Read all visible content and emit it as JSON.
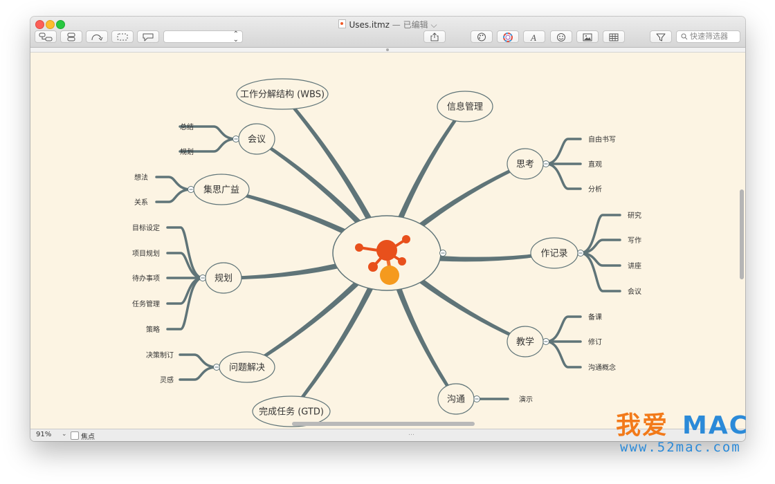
{
  "window": {
    "title": "Uses.itmz",
    "title_suffix": "— 已编辑",
    "title_chevron": "⌵"
  },
  "toolbar": {
    "style_select_value": "",
    "search_placeholder": "快速筛选器"
  },
  "mindmap": {
    "central_icon": "ithoughts-logo",
    "branches": [
      {
        "id": "wbs",
        "label": "工作分解结构 (WBS)",
        "children": []
      },
      {
        "id": "info",
        "label": "信息管理",
        "children": []
      },
      {
        "id": "meeting",
        "label": "会议",
        "children": [
          "总结",
          "规划"
        ]
      },
      {
        "id": "think",
        "label": "思考",
        "children": [
          "自由书写",
          "直观",
          "分析"
        ]
      },
      {
        "id": "brainstorm",
        "label": "集思广益",
        "children": [
          "想法",
          "关系"
        ]
      },
      {
        "id": "notes",
        "label": "作记录",
        "children": [
          "研究",
          "写作",
          "讲座",
          "会议"
        ]
      },
      {
        "id": "plan",
        "label": "规划",
        "children": [
          "目标设定",
          "项目规划",
          "待办事项",
          "任务管理",
          "策略"
        ]
      },
      {
        "id": "teach",
        "label": "教学",
        "children": [
          "备课",
          "修订",
          "沟通概念"
        ]
      },
      {
        "id": "problem",
        "label": "问题解决",
        "children": [
          "决策制订",
          "灵感"
        ]
      },
      {
        "id": "comm",
        "label": "沟通",
        "children": [
          "演示"
        ]
      },
      {
        "id": "gtd",
        "label": "完成任务 (GTD)",
        "children": []
      }
    ],
    "colors": {
      "background": "#fcf4e3",
      "line": "#5f7478",
      "node_fill": "#fcf4e3",
      "logo_orange": "#f07030",
      "logo_dark": "#e8501c"
    }
  },
  "statusbar": {
    "zoom": "91%",
    "focus_label": "焦点",
    "focus_checked": false,
    "grip": "…"
  },
  "watermark": {
    "cn": "我爱",
    "mac": "MAC",
    "url": "www.52mac.com"
  }
}
